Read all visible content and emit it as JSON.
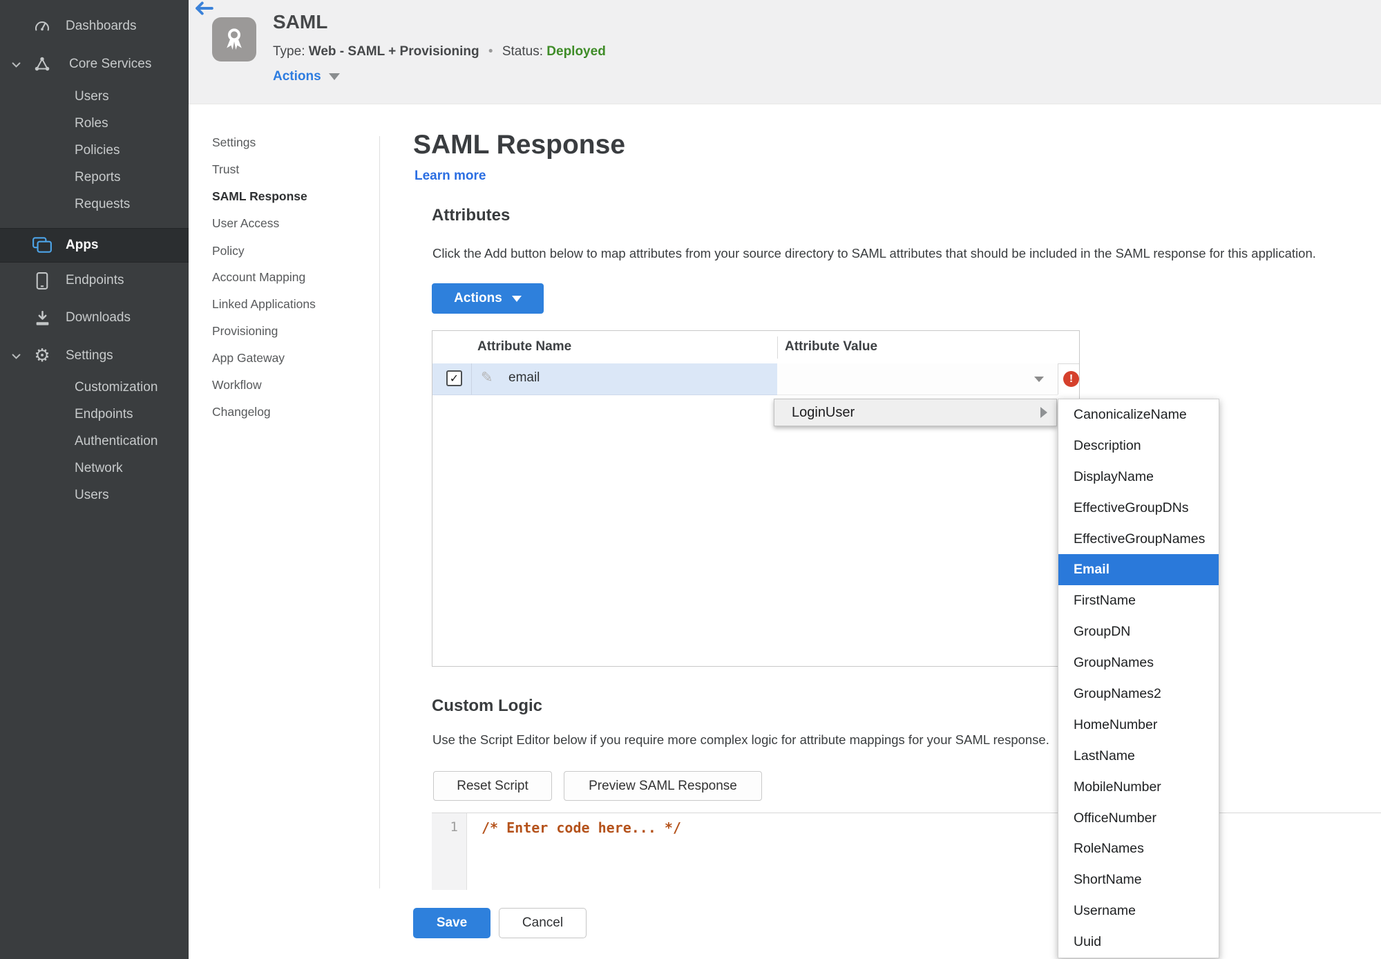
{
  "colors": {
    "accent_blue": "#2e80dc",
    "link_blue": "#2b6ee2",
    "status_green": "#3f8c28",
    "error_red": "#d5402c",
    "selected_blue": "#2a79da",
    "row_highlight": "#dbe7f7",
    "sidebar_bg": "#3a3d3f",
    "code_orange": "#b5531c"
  },
  "icons": {
    "pencil": "✎",
    "check": "✓",
    "gear": "⚙",
    "error_mark": "!"
  },
  "sidebar": {
    "items": [
      {
        "label": "Dashboards"
      },
      {
        "label": "Core Services"
      },
      {
        "label": "Users"
      },
      {
        "label": "Roles"
      },
      {
        "label": "Policies"
      },
      {
        "label": "Reports"
      },
      {
        "label": "Requests"
      },
      {
        "label": "Apps",
        "state": "active"
      },
      {
        "label": "Endpoints"
      },
      {
        "label": "Downloads"
      },
      {
        "label": "Settings"
      },
      {
        "label": "Customization"
      },
      {
        "label": "Endpoints"
      },
      {
        "label": "Authentication"
      },
      {
        "label": "Network"
      },
      {
        "label": "Users"
      }
    ]
  },
  "header": {
    "app_title": "SAML",
    "type_label": "Type:",
    "type_value": "Web - SAML + Provisioning",
    "separator": "•",
    "status_label": "Status:",
    "status_value": "Deployed",
    "actions_label": "Actions"
  },
  "sidenav": {
    "items": [
      {
        "label": "Settings"
      },
      {
        "label": "Trust"
      },
      {
        "label": "SAML Response",
        "state": "active"
      },
      {
        "label": "User Access"
      },
      {
        "label": "Policy"
      },
      {
        "label": "Account Mapping"
      },
      {
        "label": "Linked Applications"
      },
      {
        "label": "Provisioning"
      },
      {
        "label": "App Gateway"
      },
      {
        "label": "Workflow"
      },
      {
        "label": "Changelog"
      }
    ]
  },
  "main": {
    "title": "SAML Response",
    "learn_more": "Learn more",
    "attributes": {
      "heading": "Attributes",
      "description": "Click the Add button below to map attributes from your source directory to SAML attributes that should be included in the SAML response for this application.",
      "actions_button": "Actions",
      "table": {
        "columns": [
          "Attribute Name",
          "Attribute Value"
        ],
        "rows": [
          {
            "name": "email",
            "value": "",
            "checked": true,
            "error": true
          }
        ]
      }
    },
    "custom_logic": {
      "heading": "Custom Logic",
      "description": "Use the Script Editor below if you require more complex logic for attribute mappings for your SAML response.",
      "reset_button": "Reset Script",
      "preview_button": "Preview SAML Response",
      "editor": {
        "line_number": "1",
        "code": "/* Enter code here... */"
      }
    },
    "save_button": "Save",
    "cancel_button": "Cancel"
  },
  "context_menu": {
    "label": "LoginUser"
  },
  "submenu": {
    "items": [
      {
        "label": "CanonicalizeName"
      },
      {
        "label": "Description"
      },
      {
        "label": "DisplayName"
      },
      {
        "label": "EffectiveGroupDNs"
      },
      {
        "label": "EffectiveGroupNames"
      },
      {
        "label": "Email",
        "state": "selected"
      },
      {
        "label": "FirstName"
      },
      {
        "label": "GroupDN"
      },
      {
        "label": "GroupNames"
      },
      {
        "label": "GroupNames2"
      },
      {
        "label": "HomeNumber"
      },
      {
        "label": "LastName"
      },
      {
        "label": "MobileNumber"
      },
      {
        "label": "OfficeNumber"
      },
      {
        "label": "RoleNames"
      },
      {
        "label": "ShortName"
      },
      {
        "label": "Username"
      },
      {
        "label": "Uuid"
      }
    ]
  }
}
